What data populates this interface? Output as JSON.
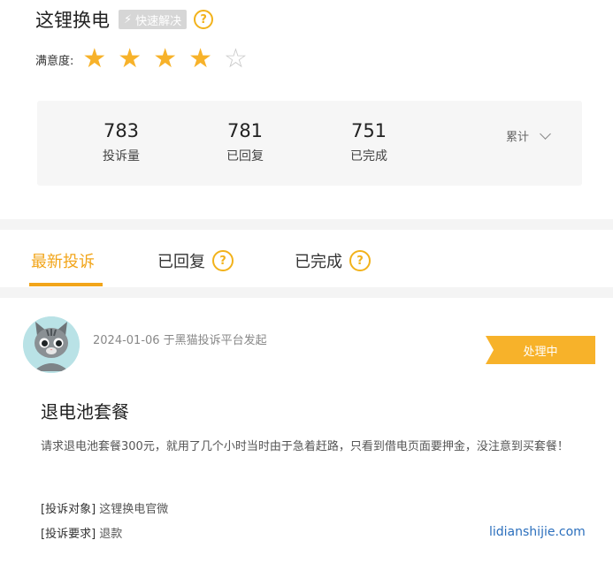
{
  "header": {
    "brand_name": "这锂换电",
    "fast_badge": "快速解决",
    "help_glyph": "?",
    "satisfaction_label": "满意度:",
    "rating": {
      "value": 4,
      "max": 5
    }
  },
  "stats": {
    "items": [
      {
        "value": "783",
        "label": "投诉量"
      },
      {
        "value": "781",
        "label": "已回复"
      },
      {
        "value": "751",
        "label": "已完成"
      }
    ],
    "period_label": "累计"
  },
  "tabs": [
    {
      "label": "最新投诉",
      "active": true
    },
    {
      "label": "已回复",
      "active": false
    },
    {
      "label": "已完成",
      "active": false
    }
  ],
  "complaint": {
    "meta": "2024-01-06 于黑猫投诉平台发起",
    "status": "处理中",
    "title": "退电池套餐",
    "body": "请求退电池套餐300元，就用了几个小时当时由于急着赶路，只看到借电页面要押金，没注意到买套餐！",
    "target_key": "[投诉对象]",
    "target_value": "这锂换电官微",
    "request_key": "[投诉要求]",
    "request_value": "退款"
  },
  "watermark": "lidianshijie.com",
  "colors": {
    "accent": "#f2a51a",
    "star": "#f7b22a",
    "watermark": "#2b6fbd"
  }
}
